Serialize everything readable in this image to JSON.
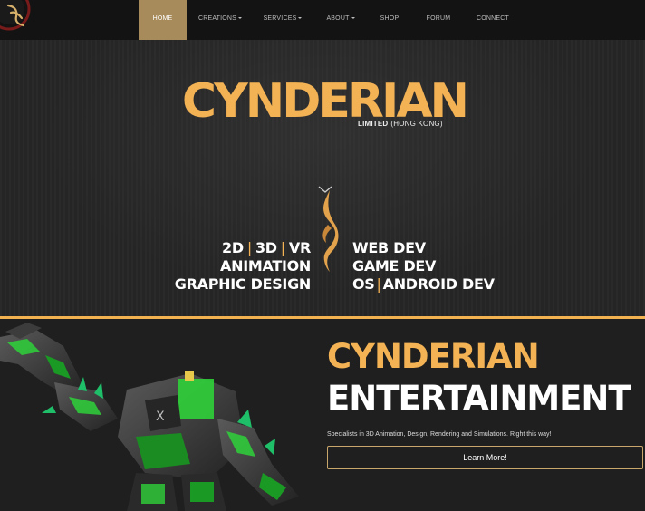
{
  "nav": {
    "items": [
      {
        "label": "HOME",
        "dropdown": false,
        "active": true
      },
      {
        "label": "CREATIONS",
        "dropdown": true,
        "active": false
      },
      {
        "label": "SERVICES",
        "dropdown": true,
        "active": false
      },
      {
        "label": "ABOUT",
        "dropdown": true,
        "active": false
      },
      {
        "label": "SHOP",
        "dropdown": false,
        "active": false
      },
      {
        "label": "FORUM",
        "dropdown": false,
        "active": false
      },
      {
        "label": "CONNECT",
        "dropdown": false,
        "active": false
      }
    ]
  },
  "hero": {
    "title": "CYNDERIAN",
    "subtitle_bold": "LIMITED",
    "subtitle_region": "(HONG KONG)",
    "skills_left": {
      "line1": [
        "2D",
        "3D",
        "VR"
      ],
      "line2": "ANIMATION",
      "line3": "GRAPHIC DESIGN"
    },
    "skills_right": {
      "line1": "WEB DEV",
      "line2": "GAME DEV",
      "line3": [
        "OS",
        "ANDROID DEV"
      ]
    }
  },
  "entertainment": {
    "title_line1": "CYNDERIAN",
    "title_line2": "ENTERTAINMENT",
    "description": "Specialists in 3D Animation, Design, Rendering and Simulations. Right this way!",
    "button_label": "Learn More!"
  },
  "colors": {
    "accent_gold": "#f3b254",
    "nav_active": "#a88b5a",
    "navbar_bg": "#131313",
    "hero_bg": "#262626",
    "robot_green": "#2fd13a"
  }
}
